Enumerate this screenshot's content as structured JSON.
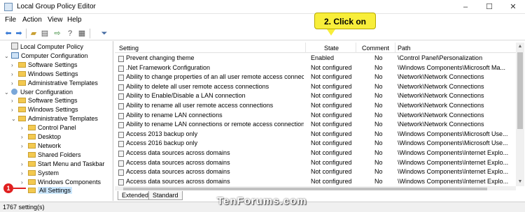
{
  "window": {
    "title": "Local Group Policy Editor",
    "minimize": "–",
    "maximize": "☐",
    "close": "✕"
  },
  "menu": [
    "File",
    "Action",
    "View",
    "Help"
  ],
  "toolbar": {
    "icons": [
      "back-icon",
      "forward-icon",
      "up-folder-icon",
      "show-hide-tree-icon",
      "export-icon",
      "help-icon",
      "properties-icon",
      "filter-icon"
    ]
  },
  "tree": [
    {
      "label": "Local Computer Policy",
      "level": 0,
      "chev": "",
      "icon": "policy"
    },
    {
      "label": "Computer Configuration",
      "level": 0,
      "chev": "⌄",
      "icon": "pc"
    },
    {
      "label": "Software Settings",
      "level": 1,
      "chev": "›",
      "icon": "folder"
    },
    {
      "label": "Windows Settings",
      "level": 1,
      "chev": "›",
      "icon": "folder"
    },
    {
      "label": "Administrative Templates",
      "level": 1,
      "chev": "›",
      "icon": "folder"
    },
    {
      "label": "User Configuration",
      "level": 0,
      "chev": "⌄",
      "icon": "user"
    },
    {
      "label": "Software Settings",
      "level": 1,
      "chev": "›",
      "icon": "folder"
    },
    {
      "label": "Windows Settings",
      "level": 1,
      "chev": "›",
      "icon": "folder"
    },
    {
      "label": "Administrative Templates",
      "level": 1,
      "chev": "⌄",
      "icon": "folder"
    },
    {
      "label": "Control Panel",
      "level": 2,
      "chev": "›",
      "icon": "folder"
    },
    {
      "label": "Desktop",
      "level": 2,
      "chev": "›",
      "icon": "folder"
    },
    {
      "label": "Network",
      "level": 2,
      "chev": "›",
      "icon": "folder"
    },
    {
      "label": "Shared Folders",
      "level": 2,
      "chev": "",
      "icon": "folder"
    },
    {
      "label": "Start Menu and Taskbar",
      "level": 2,
      "chev": "›",
      "icon": "folder"
    },
    {
      "label": "System",
      "level": 2,
      "chev": "›",
      "icon": "folder"
    },
    {
      "label": "Windows Components",
      "level": 2,
      "chev": "›",
      "icon": "folder"
    },
    {
      "label": "All Settings",
      "level": 2,
      "chev": "",
      "icon": "folder",
      "selected": true
    }
  ],
  "columns": {
    "setting": "Setting",
    "state": "State",
    "comment": "Comment",
    "path": "Path"
  },
  "rows": [
    {
      "setting": "Prevent changing theme",
      "state": "Enabled",
      "comment": "No",
      "path": "\\Control Panel\\Personalization"
    },
    {
      "setting": ".Net Framework Configuration",
      "state": "Not configured",
      "comment": "No",
      "path": "\\Windows Components\\Microsoft Ma..."
    },
    {
      "setting": "Ability to change properties of an all user remote access connection",
      "state": "Not configured",
      "comment": "No",
      "path": "\\Network\\Network Connections"
    },
    {
      "setting": "Ability to delete all user remote access connections",
      "state": "Not configured",
      "comment": "No",
      "path": "\\Network\\Network Connections"
    },
    {
      "setting": "Ability to Enable/Disable a LAN connection",
      "state": "Not configured",
      "comment": "No",
      "path": "\\Network\\Network Connections"
    },
    {
      "setting": "Ability to rename all user remote access connections",
      "state": "Not configured",
      "comment": "No",
      "path": "\\Network\\Network Connections"
    },
    {
      "setting": "Ability to rename LAN connections",
      "state": "Not configured",
      "comment": "No",
      "path": "\\Network\\Network Connections"
    },
    {
      "setting": "Ability to rename LAN connections or remote access connections",
      "state": "Not configured",
      "comment": "No",
      "path": "\\Network\\Network Connections"
    },
    {
      "setting": "Access 2013 backup only",
      "state": "Not configured",
      "comment": "No",
      "path": "\\Windows Components\\Microsoft Use..."
    },
    {
      "setting": "Access 2016 backup only",
      "state": "Not configured",
      "comment": "No",
      "path": "\\Windows Components\\Microsoft Use..."
    },
    {
      "setting": "Access data sources across domains",
      "state": "Not configured",
      "comment": "No",
      "path": "\\Windows Components\\Internet Explo..."
    },
    {
      "setting": "Access data sources across domains",
      "state": "Not configured",
      "comment": "No",
      "path": "\\Windows Components\\Internet Explo..."
    },
    {
      "setting": "Access data sources across domains",
      "state": "Not configured",
      "comment": "No",
      "path": "\\Windows Components\\Internet Explo..."
    },
    {
      "setting": "Access data sources across domains",
      "state": "Not configured",
      "comment": "No",
      "path": "\\Windows Components\\Internet Explo..."
    }
  ],
  "tabs": [
    "Extended",
    "Standard"
  ],
  "status": "1767 setting(s)",
  "annotations": {
    "callout": "2. Click on",
    "step1": "1",
    "watermark": "TenForums.com"
  },
  "colors": {
    "callout": "#f8ee3a",
    "step_marker": "#e02020",
    "selection": "#cce8ff"
  }
}
